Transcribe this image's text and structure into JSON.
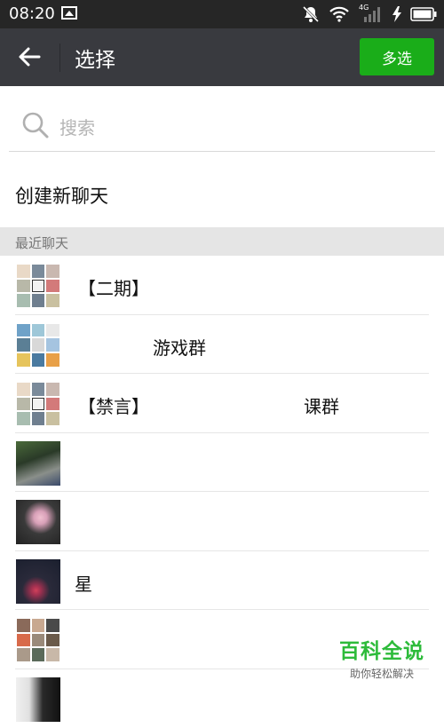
{
  "status_bar": {
    "time": "08:20",
    "network": "4G"
  },
  "app_bar": {
    "title": "选择",
    "multi_select_label": "多选"
  },
  "search": {
    "placeholder": "搜索"
  },
  "create_new_chat": "创建新聊天",
  "section_header": "最近聊天",
  "chats": [
    {
      "name_left": "【二期】",
      "name_right": "",
      "avatar": "group-grid"
    },
    {
      "name_left": "",
      "name_right": "游戏群",
      "avatar": "group-grid"
    },
    {
      "name_left": "【禁言】",
      "name_right": "课群",
      "avatar": "group-grid"
    },
    {
      "name_left": "",
      "name_right": "",
      "avatar": "photo-dark"
    },
    {
      "name_left": "",
      "name_right": "",
      "avatar": "flower-photo"
    },
    {
      "name_left": "星",
      "name_right": "",
      "avatar": "night-photo"
    },
    {
      "name_left": "",
      "name_right": "",
      "avatar": "group-grid"
    },
    {
      "name_left": "",
      "name_right": "",
      "avatar": "photo-dark"
    }
  ],
  "watermark": {
    "title": "百科全说",
    "subtitle": "助你轻松解决"
  },
  "colors": {
    "appbar": "#393a3f",
    "accent_green": "#1aad19",
    "statusbar": "#262626"
  }
}
